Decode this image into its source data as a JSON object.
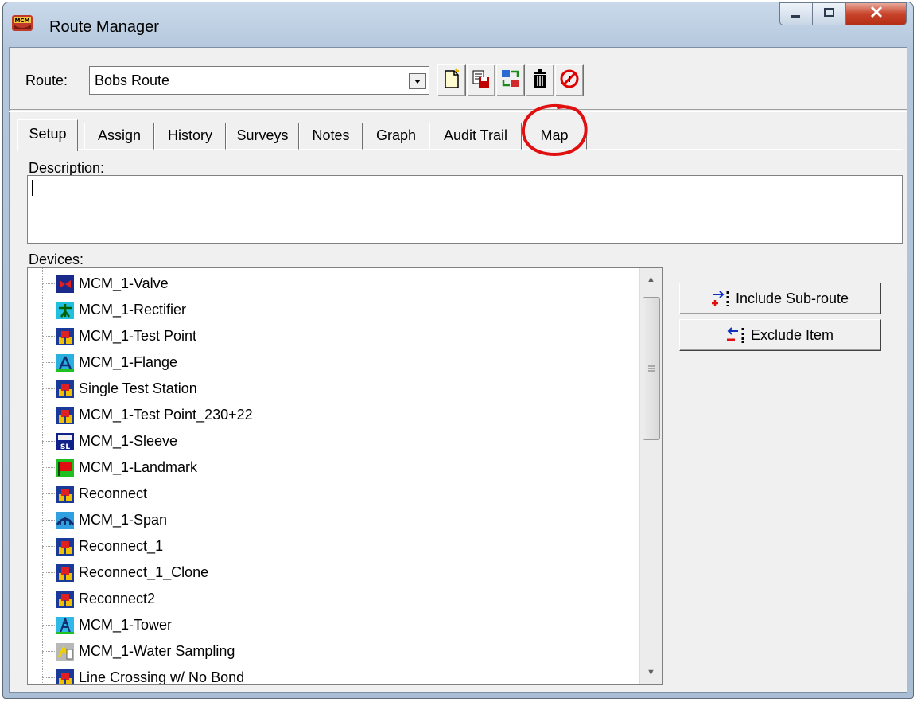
{
  "window": {
    "title": "Route Manager",
    "app_icon": "mcm-logo-icon",
    "controls": [
      "minimize-icon",
      "maximize-icon",
      "close-icon"
    ]
  },
  "toolbar": {
    "route_label": "Route:",
    "route_value": "Bobs Route",
    "buttons": [
      {
        "name": "new-route-button",
        "icon": "new-document-icon"
      },
      {
        "name": "save-route-button",
        "icon": "save-icon"
      },
      {
        "name": "assign-route-button",
        "icon": "transfer-icon"
      },
      {
        "name": "delete-route-button",
        "icon": "trash-icon"
      },
      {
        "name": "stop-button",
        "icon": "no-entry-icon"
      }
    ]
  },
  "tabs": [
    {
      "label": "Setup",
      "active": true
    },
    {
      "label": "Assign"
    },
    {
      "label": "History"
    },
    {
      "label": "Surveys"
    },
    {
      "label": "Notes"
    },
    {
      "label": "Graph"
    },
    {
      "label": "Audit Trail"
    },
    {
      "label": "Map",
      "highlighted": true
    }
  ],
  "setup": {
    "description_label": "Description:",
    "description_value": "",
    "devices_label": "Devices:",
    "devices": [
      {
        "label": "MCM_1-Valve",
        "icon": "valve-icon"
      },
      {
        "label": "MCM_1-Rectifier",
        "icon": "rectifier-icon"
      },
      {
        "label": "MCM_1-Test Point",
        "icon": "test-point-icon"
      },
      {
        "label": "MCM_1-Flange",
        "icon": "flange-icon"
      },
      {
        "label": "Single Test Station",
        "icon": "test-point-icon"
      },
      {
        "label": "MCM_1-Test Point_230+22",
        "icon": "test-point-icon"
      },
      {
        "label": "MCM_1-Sleeve",
        "icon": "sleeve-icon"
      },
      {
        "label": "MCM_1-Landmark",
        "icon": "landmark-flag-icon"
      },
      {
        "label": "Reconnect",
        "icon": "test-point-icon"
      },
      {
        "label": "MCM_1-Span",
        "icon": "span-icon"
      },
      {
        "label": "Reconnect_1",
        "icon": "test-point-icon"
      },
      {
        "label": "Reconnect_1_Clone",
        "icon": "test-point-icon"
      },
      {
        "label": "Reconnect2",
        "icon": "test-point-icon"
      },
      {
        "label": "MCM_1-Tower",
        "icon": "tower-icon"
      },
      {
        "label": "MCM_1-Water Sampling",
        "icon": "water-sampling-icon"
      },
      {
        "label": "Line Crossing w/ No Bond",
        "icon": "test-point-icon"
      }
    ],
    "include_button": "Include Sub-route",
    "exclude_button": "Exclude Item"
  },
  "colors": {
    "highlight_circle": "#e01010",
    "titlebar": "#b4c7dc",
    "close_button": "#c7432a"
  }
}
